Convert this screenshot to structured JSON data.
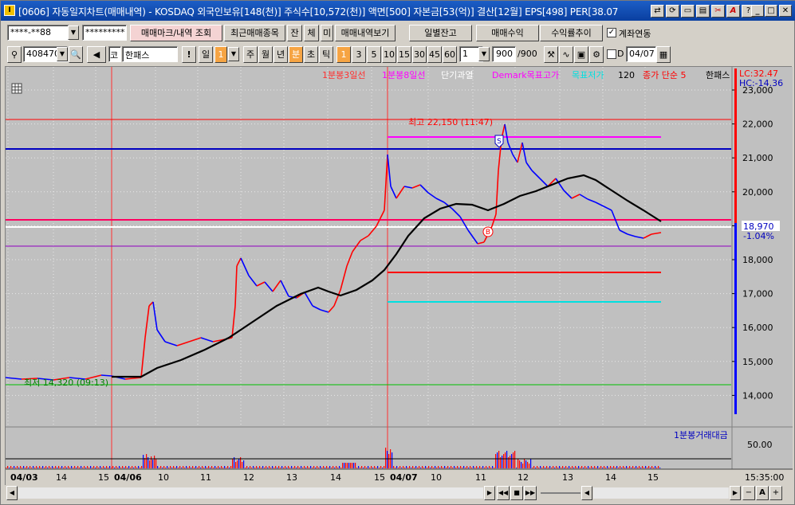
{
  "window": {
    "title": "[0606] 자동일지차트(매매내역) - KOSDAQ 외국인보유[148(천)] 주식수[10,572(천)] 액면[500] 자본금[53(억)] 결산[12월] EPS[498] PER[38.07",
    "app_icon": "I"
  },
  "toolbar1": {
    "account": "****-**88",
    "password": "*********",
    "btn_trade_mark": "매매마크/내역 조회",
    "btn_recent": "최근매매종목",
    "btn_jan": "잔",
    "btn_che": "체",
    "btn_mi": "미",
    "btn_history": "매매내역보기",
    "btn_daily_balance": "일별잔고",
    "btn_trade_profit": "매매수익",
    "btn_return_trend": "수익률추이",
    "link_label": "계좌연동",
    "link_checked": true
  },
  "toolbar2": {
    "code": "408470",
    "market": "코",
    "stock_name": "한패스",
    "period_day": "일",
    "period_num": "1",
    "period_week": "주",
    "period_month": "월",
    "period_year": "년",
    "period_min": "분",
    "period_tick_cho": "초",
    "period_tick": "틱",
    "intervals": [
      "1",
      "3",
      "5",
      "10",
      "15",
      "30",
      "45",
      "60"
    ],
    "interval_value": "1",
    "count": "900",
    "count_total": "/900",
    "date_checkbox": "D",
    "date": "04/07"
  },
  "legend": {
    "items": [
      {
        "text": "1분봉3일선",
        "color": "#ff3030"
      },
      {
        "text": "1분봉8일선",
        "color": "#ff00ff"
      },
      {
        "text": "단기과열",
        "color": "#ffffff"
      },
      {
        "text": "Demark목표고가",
        "color": "#ff00ff"
      },
      {
        "text": "목표저가",
        "color": "#00e0e0"
      },
      {
        "text": "120",
        "color": "#000000"
      },
      {
        "text": "종가 단순 5",
        "color": "#ff0000"
      },
      {
        "text": "한패스",
        "color": "#000000"
      }
    ],
    "volume_legend": "1분봉거래대금"
  },
  "price_panel": {
    "lc": "LC:32.47",
    "hc": "HC:-14.36",
    "high_label": "최고 22,150 (11:47)",
    "low_label": "최저 14,320 (09:13)",
    "current_price": "18,970",
    "current_change": "-1.04%",
    "axis_labels": [
      "23,000",
      "22,000",
      "21,000",
      "20,000",
      "19,000",
      "18,000",
      "17,000",
      "16,000",
      "15,000",
      "14,000"
    ],
    "marker_s": "S",
    "marker_b": "B"
  },
  "volume_panel": {
    "axis_label": "50.00"
  },
  "time_axis": {
    "labels": [
      "04/03",
      "14",
      "15",
      "04/06",
      "10",
      "11",
      "12",
      "13",
      "14",
      "15",
      "04/07",
      "10",
      "11",
      "12",
      "13",
      "14",
      "15"
    ],
    "last_time": "15:35:00"
  },
  "colors": {
    "chart_bg": "#c0c0c0",
    "up": "#ff0000",
    "down": "#0000ff",
    "ma_long": "#000000",
    "title_bar": "#0a3fa0"
  }
}
